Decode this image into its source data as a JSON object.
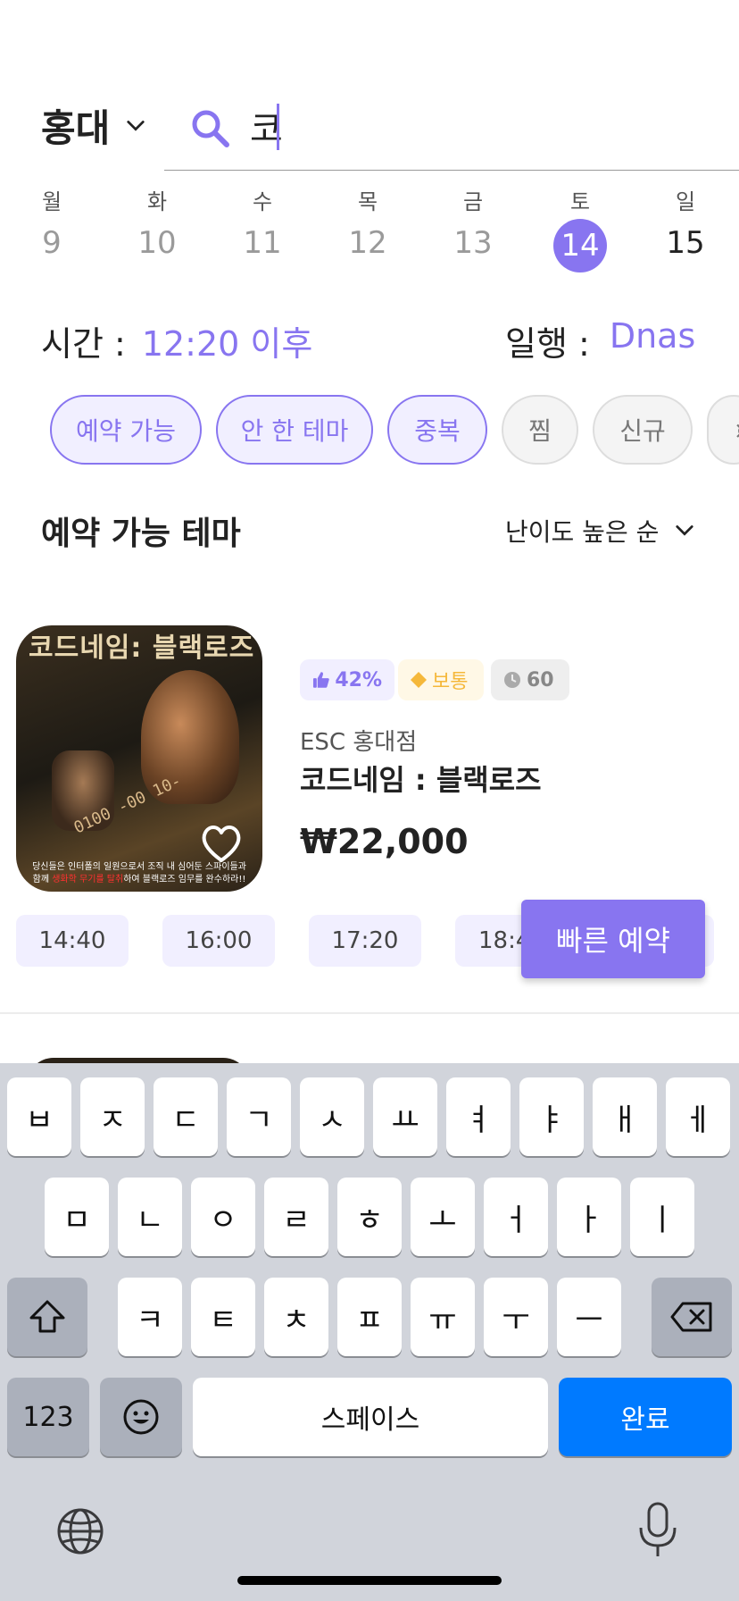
{
  "header": {
    "region": "홍대",
    "search_value": "코"
  },
  "dates": [
    {
      "dow": "월",
      "day": "9"
    },
    {
      "dow": "화",
      "day": "10"
    },
    {
      "dow": "수",
      "day": "11"
    },
    {
      "dow": "목",
      "day": "12"
    },
    {
      "dow": "금",
      "day": "13"
    },
    {
      "dow": "토",
      "day": "14"
    },
    {
      "dow": "일",
      "day": "15"
    }
  ],
  "filters": {
    "time_label": "시간 :",
    "time_value": "12:20 이후",
    "party_label": "일행 :",
    "party_value": "Dnas"
  },
  "chips": [
    "예약 가능",
    "안 한 테마",
    "중복",
    "찜",
    "신규",
    "¤"
  ],
  "section": {
    "title": "예약 가능 테마",
    "sort": "난이도 높은 순"
  },
  "theme": {
    "poster_title": "코드네임: 블랙로즈",
    "poster_caption_1": "당신들은 인터폴의 일원으로서 조직 내 심어둔 스파이들과",
    "poster_caption_2a": "함께 ",
    "poster_caption_2b": "생화학 무기를 탈취",
    "poster_caption_2c": "하여 블랙로즈 임무를 완수하라!!",
    "like": "42%",
    "level": "보통",
    "duration": "60",
    "store": "ESC 홍대점",
    "name": "코드네임 : 블랙로즈",
    "price": "₩22,000",
    "slots": [
      "14:40",
      "16:00",
      "17:20",
      "18:4"
    ],
    "quick_button": "빠른 예약"
  },
  "keyboard": {
    "row1": [
      "ㅂ",
      "ㅈ",
      "ㄷ",
      "ㄱ",
      "ㅅ",
      "ㅛ",
      "ㅕ",
      "ㅑ",
      "ㅐ",
      "ㅔ"
    ],
    "row2": [
      "ㅁ",
      "ㄴ",
      "ㅇ",
      "ㄹ",
      "ㅎ",
      "ㅗ",
      "ㅓ",
      "ㅏ",
      "ㅣ"
    ],
    "row3": [
      "ㅋ",
      "ㅌ",
      "ㅊ",
      "ㅍ",
      "ㅠ",
      "ㅜ",
      "ㅡ"
    ],
    "numbers": "123",
    "space": "스페이스",
    "done": "완료"
  },
  "colors": {
    "accent": "#8875f0",
    "keyboard_bg": "#d1d4db",
    "done_key": "#007aff"
  }
}
